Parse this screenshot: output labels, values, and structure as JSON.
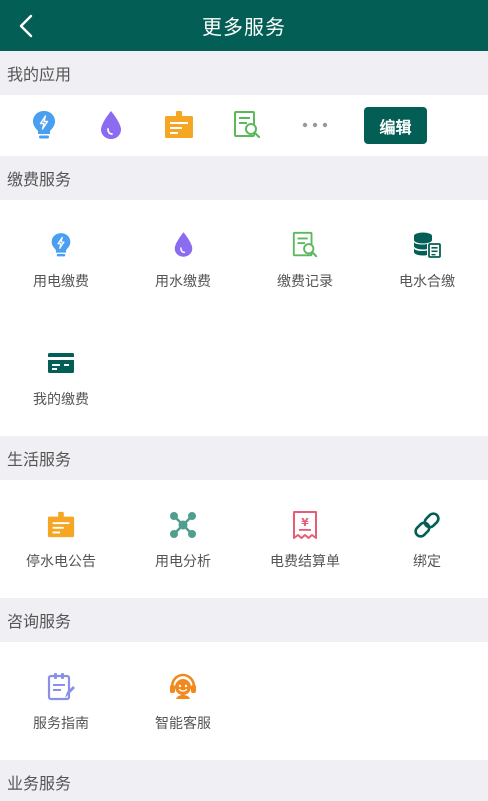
{
  "header": {
    "title": "更多服务",
    "back_icon": "chevron-left-icon"
  },
  "my_apps": {
    "title": "我的应用",
    "icons": [
      "bulb-icon",
      "water-drop-icon",
      "notice-board-icon",
      "record-search-icon",
      "more-dots-icon"
    ],
    "edit_label": "编辑"
  },
  "payment": {
    "title": "缴费服务",
    "items": [
      {
        "label": "用电缴费",
        "icon": "bulb-icon"
      },
      {
        "label": "用水缴费",
        "icon": "water-drop-icon"
      },
      {
        "label": "缴费记录",
        "icon": "record-search-icon"
      },
      {
        "label": "电水合缴",
        "icon": "coin-stack-icon"
      },
      {
        "label": "我的缴费",
        "icon": "card-icon"
      }
    ]
  },
  "life": {
    "title": "生活服务",
    "items": [
      {
        "label": "停水电公告",
        "icon": "notice-board-icon"
      },
      {
        "label": "用电分析",
        "icon": "network-icon"
      },
      {
        "label": "电费结算单",
        "icon": "receipt-yen-icon"
      },
      {
        "label": "绑定",
        "icon": "link-icon"
      }
    ]
  },
  "consult": {
    "title": "咨询服务",
    "items": [
      {
        "label": "服务指南",
        "icon": "guide-edit-icon"
      },
      {
        "label": "智能客服",
        "icon": "headset-agent-icon"
      }
    ]
  },
  "business": {
    "title": "业务服务"
  },
  "colors": {
    "brand": "#035f55",
    "blue": "#4a9ff0",
    "purple": "#8b6bf0",
    "orange": "#f5a623",
    "green": "#5cb85c",
    "teal": "#4f9e8e",
    "pink": "#e85d75",
    "lavender": "#8a8fe8"
  }
}
